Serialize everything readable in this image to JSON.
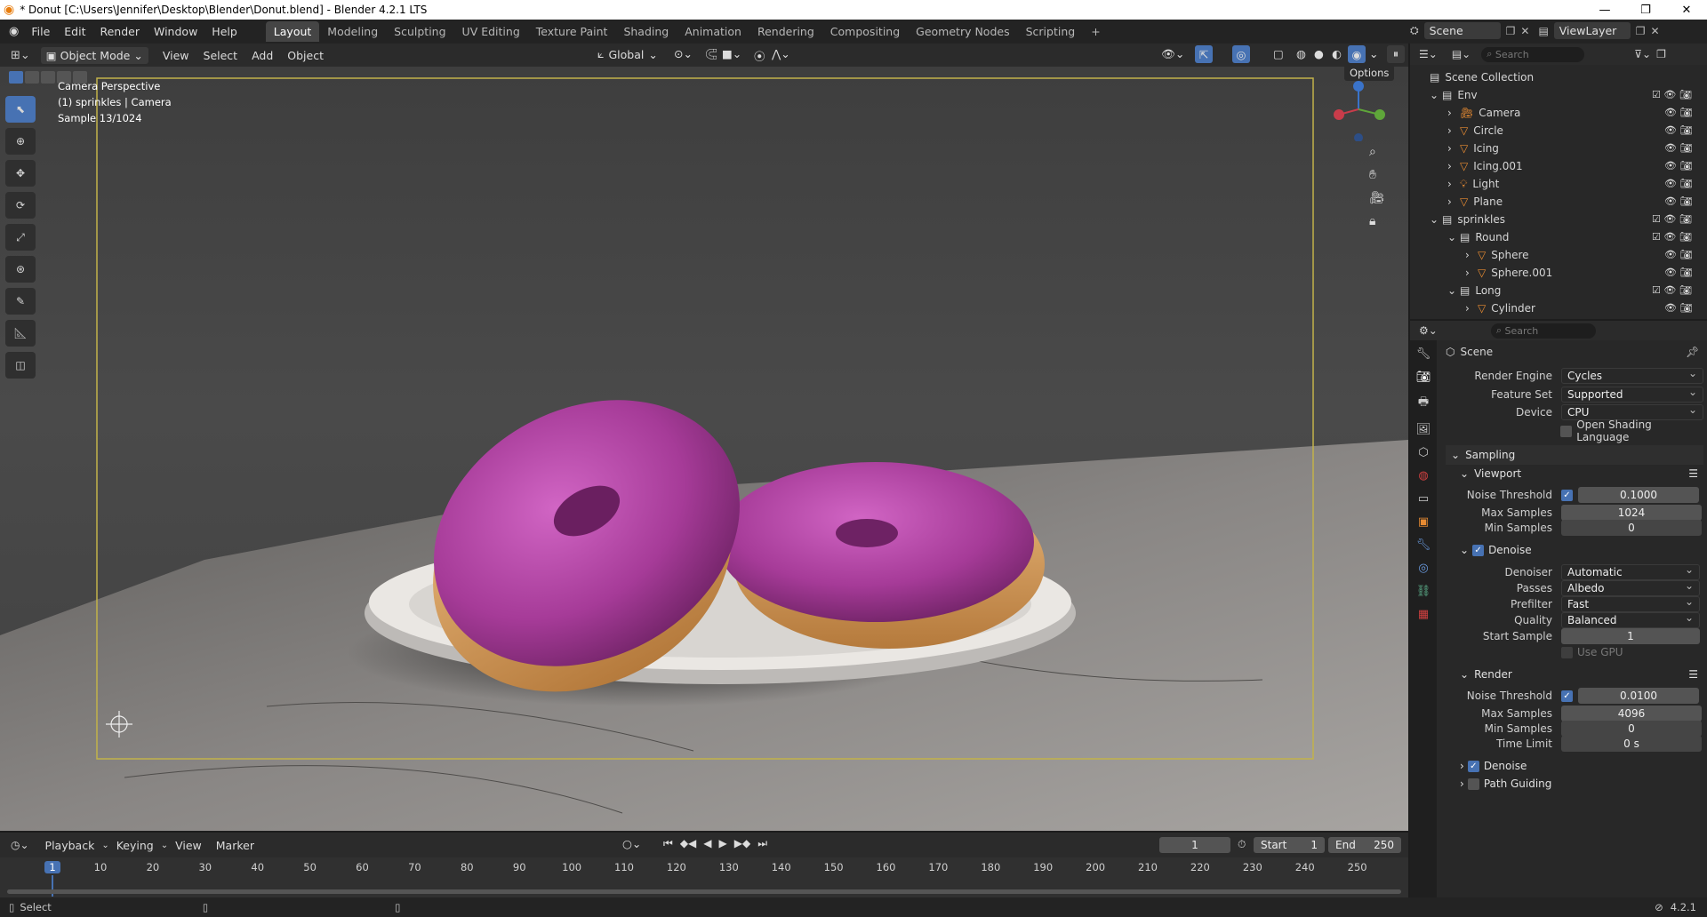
{
  "window": {
    "title": "* Donut [C:\\Users\\Jennifer\\Desktop\\Blender\\Donut.blend] - Blender 4.2.1 LTS"
  },
  "menus": [
    "File",
    "Edit",
    "Render",
    "Window",
    "Help"
  ],
  "workspaces": [
    "Layout",
    "Modeling",
    "Sculpting",
    "UV Editing",
    "Texture Paint",
    "Shading",
    "Animation",
    "Rendering",
    "Compositing",
    "Geometry Nodes",
    "Scripting"
  ],
  "active_workspace": "Layout",
  "scene_selector": "Scene",
  "view_layer": "ViewLayer",
  "viewport_header": {
    "mode": "Object Mode",
    "menus": [
      "View",
      "Select",
      "Add",
      "Object"
    ],
    "orientation": "Global",
    "options": "Options"
  },
  "overlay_text": {
    "line1": "Camera Perspective",
    "line2": "(1) sprinkles | Camera",
    "line3": "Sample 13/1024"
  },
  "outliner": {
    "search_placeholder": "Search",
    "root": "Scene Collection",
    "rows": [
      {
        "label": "Env"
      },
      {
        "label": "Camera"
      },
      {
        "label": "Circle"
      },
      {
        "label": "Icing"
      },
      {
        "label": "Icing.001"
      },
      {
        "label": "Light"
      },
      {
        "label": "Plane"
      },
      {
        "label": "sprinkles"
      },
      {
        "label": "Round"
      },
      {
        "label": "Sphere"
      },
      {
        "label": "Sphere.001"
      },
      {
        "label": "Long"
      },
      {
        "label": "Cylinder"
      }
    ]
  },
  "properties": {
    "search_placeholder": "Search",
    "context": "Scene",
    "render_engine_label": "Render Engine",
    "render_engine": "Cycles",
    "feature_set_label": "Feature Set",
    "feature_set": "Supported",
    "device_label": "Device",
    "device": "CPU",
    "osl_label": "Open Shading Language",
    "sampling": "Sampling",
    "viewport": "Viewport",
    "noise_threshold_label": "Noise Threshold",
    "vp_noise_threshold": "0.1000",
    "max_samples_label": "Max Samples",
    "vp_max_samples": "1024",
    "min_samples_label": "Min Samples",
    "vp_min_samples": "0",
    "denoise": "Denoise",
    "denoiser_label": "Denoiser",
    "denoiser": "Automatic",
    "passes_label": "Passes",
    "passes": "Albedo",
    "prefilter_label": "Prefilter",
    "prefilter": "Fast",
    "quality_label": "Quality",
    "quality": "Balanced",
    "start_sample_label": "Start Sample",
    "start_sample": "1",
    "use_gpu": "Use GPU",
    "render": "Render",
    "r_noise_threshold": "0.0100",
    "r_max_samples": "4096",
    "r_min_samples": "0",
    "time_limit_label": "Time Limit",
    "time_limit": "0 s",
    "r_denoise": "Denoise",
    "path_guiding": "Path Guiding"
  },
  "timeline": {
    "menus": [
      "Playback",
      "Keying",
      "View",
      "Marker"
    ],
    "current_frame": "1",
    "start_label": "Start",
    "start": "1",
    "end_label": "End",
    "end": "250",
    "ticks": [
      "1",
      "10",
      "20",
      "30",
      "40",
      "50",
      "60",
      "70",
      "80",
      "90",
      "100",
      "110",
      "120",
      "130",
      "140",
      "150",
      "160",
      "170",
      "180",
      "190",
      "200",
      "210",
      "220",
      "230",
      "240",
      "250"
    ]
  },
  "status": {
    "select": "Select",
    "version": "4.2.1"
  }
}
